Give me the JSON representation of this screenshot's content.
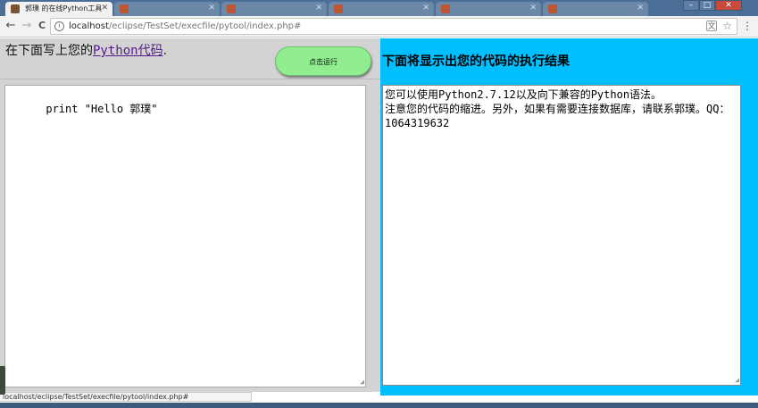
{
  "browser": {
    "tabs": [
      {
        "title": "郭璞 的在线Python工具",
        "active": true
      },
      {
        "title": "",
        "active": false
      },
      {
        "title": "",
        "active": false
      },
      {
        "title": "",
        "active": false
      },
      {
        "title": "",
        "active": false
      },
      {
        "title": "",
        "active": false
      }
    ],
    "window_controls": [
      "–",
      "□",
      "✕"
    ],
    "nav": {
      "back": "←",
      "forward": "→",
      "reload": "C"
    },
    "url_host": "localhost",
    "url_path": "/eclipse/TestSet/execfile/pytool/index.php#",
    "icons": {
      "page": "info-icon",
      "translate": "translate-icon",
      "star": "star-icon",
      "menu": "menu-icon"
    }
  },
  "left": {
    "title_prefix": "在下面写上您的",
    "title_link": "Python代码",
    "title_suffix": ".",
    "run_button": "点击运行",
    "code": "print \"Hello 郭璞\""
  },
  "right": {
    "title": "下面将显示出您的代码的执行结果",
    "output_lines": [
      "您可以使用Python2.7.12以及向下兼容的Python语法。",
      "注意您的代码的缩进。另外，如果有需要连接数据库，请联系郭璞。QQ：1064319632"
    ]
  },
  "status_bar": "localhost/eclipse/TestSet/execfile/pytool/index.php#",
  "colors": {
    "left_bg": "#d3d3d3",
    "right_bg": "#00bfff",
    "run_button": "#90ee90",
    "link": "#551a8b"
  }
}
